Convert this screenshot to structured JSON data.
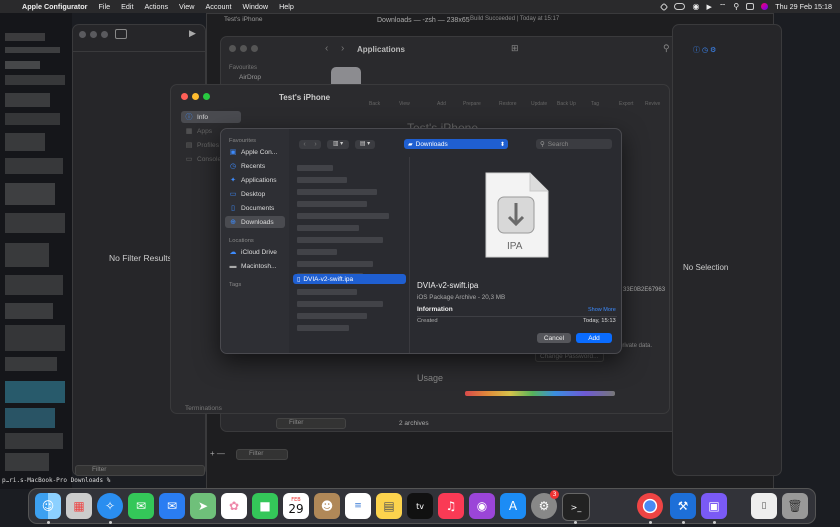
{
  "menubar": {
    "app_name": "Apple Configurator",
    "items": [
      "File",
      "Edit",
      "Actions",
      "View",
      "Account",
      "Window",
      "Help"
    ],
    "clock": "Thu 29 Feb  15:18"
  },
  "terminal": {
    "title": "Downloads — -zsh — 238x65",
    "prompt": "p…ri.s-MacBook-Pro Downloads % "
  },
  "configurator_left": {
    "empty_text": "No Filter Results",
    "filter_placeholder": "Filter"
  },
  "apps_window": {
    "tab_title": "Test's iPhone",
    "title": "Applications",
    "favourites_label": "Favourites",
    "airdrop_label": "AirDrop",
    "filter_placeholder": "Filter",
    "count": "2 archives",
    "build_status": "Build Succeeded | Today at 15:17"
  },
  "device_window": {
    "title": "Test's iPhone",
    "nav": [
      "Info",
      "Apps",
      "Profiles",
      "Console"
    ],
    "toolbar": [
      "Back",
      "View",
      "Add",
      "Prepare",
      "Restore",
      "Update",
      "Back Up",
      "Tag",
      "Export",
      "Revive"
    ],
    "heading": "Test's iPhone",
    "change_password": "Change Password...",
    "usage_label": "Usage",
    "terminations": "Terminations",
    "private_data": "private data."
  },
  "right_panel": {
    "no_selection": "No Selection",
    "partial_id": "33E0B2E67963"
  },
  "dialog": {
    "location": "Downloads",
    "search_placeholder": "Search",
    "favourites_label": "Favourites",
    "favourites": [
      {
        "icon": "apple-configurator-icon",
        "label": "Apple Con..."
      },
      {
        "icon": "clock-icon",
        "label": "Recents"
      },
      {
        "icon": "applications-icon",
        "label": "Applications"
      },
      {
        "icon": "desktop-icon",
        "label": "Desktop"
      },
      {
        "icon": "document-icon",
        "label": "Documents"
      },
      {
        "icon": "downloads-icon",
        "label": "Downloads"
      }
    ],
    "locations_label": "Locations",
    "locations": [
      {
        "icon": "cloud-icon",
        "label": "iCloud Drive"
      },
      {
        "icon": "disk-icon",
        "label": "Macintosh..."
      }
    ],
    "tags_label": "Tags",
    "selected_file": "DVIA-v2-swift.ipa",
    "preview": {
      "badge": "IPA",
      "file_name": "DVIA-v2-swift.ipa",
      "kind": "iOS Package Archive - 20,3 MB",
      "info_label": "Information",
      "show_more": "Show More",
      "created_label": "Created",
      "created_value": "Today, 15:13"
    },
    "cancel_label": "Cancel",
    "add_label": "Add"
  },
  "dock": {
    "calendar_month": "FEB",
    "calendar_day": "29",
    "settings_badge": "3",
    "apps": [
      "finder",
      "launchpad",
      "safari",
      "messages",
      "mail",
      "maps",
      "photos",
      "facetime",
      "calendar",
      "contacts",
      "reminders",
      "notes",
      "tv",
      "music",
      "podcasts",
      "app-store",
      "system-settings",
      "terminal",
      "chrome",
      "xcode",
      "configurator",
      "downloads",
      "trash"
    ]
  },
  "colors": {
    "accent": "#0a6cff",
    "selection": "#1f5fd1",
    "dialog_bg": "#2a2b30"
  }
}
